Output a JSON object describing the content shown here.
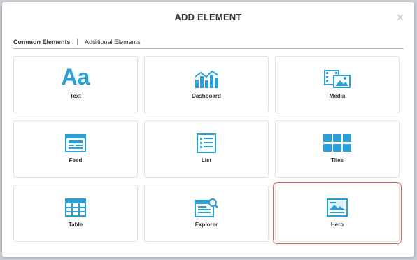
{
  "dialog": {
    "title": "ADD ELEMENT",
    "close_glyph": "×"
  },
  "tabs": [
    {
      "label": "Common Elements",
      "active": true
    },
    {
      "label": "Additional Elements",
      "active": false
    }
  ],
  "tab_separator": "|",
  "icon_text": "Aa",
  "elements": [
    {
      "label": "Text",
      "icon": "text-icon"
    },
    {
      "label": "Dashboard",
      "icon": "dashboard-icon"
    },
    {
      "label": "Media",
      "icon": "media-icon"
    },
    {
      "label": "Feed",
      "icon": "feed-icon"
    },
    {
      "label": "List",
      "icon": "list-icon"
    },
    {
      "label": "Tiles",
      "icon": "tiles-icon"
    },
    {
      "label": "Table",
      "icon": "table-icon"
    },
    {
      "label": "Explorer",
      "icon": "explorer-icon"
    },
    {
      "label": "Hero",
      "icon": "hero-icon",
      "selected": true
    }
  ],
  "colors": {
    "icon_blue": "#2aa0d6",
    "selected_border": "#e06060"
  }
}
